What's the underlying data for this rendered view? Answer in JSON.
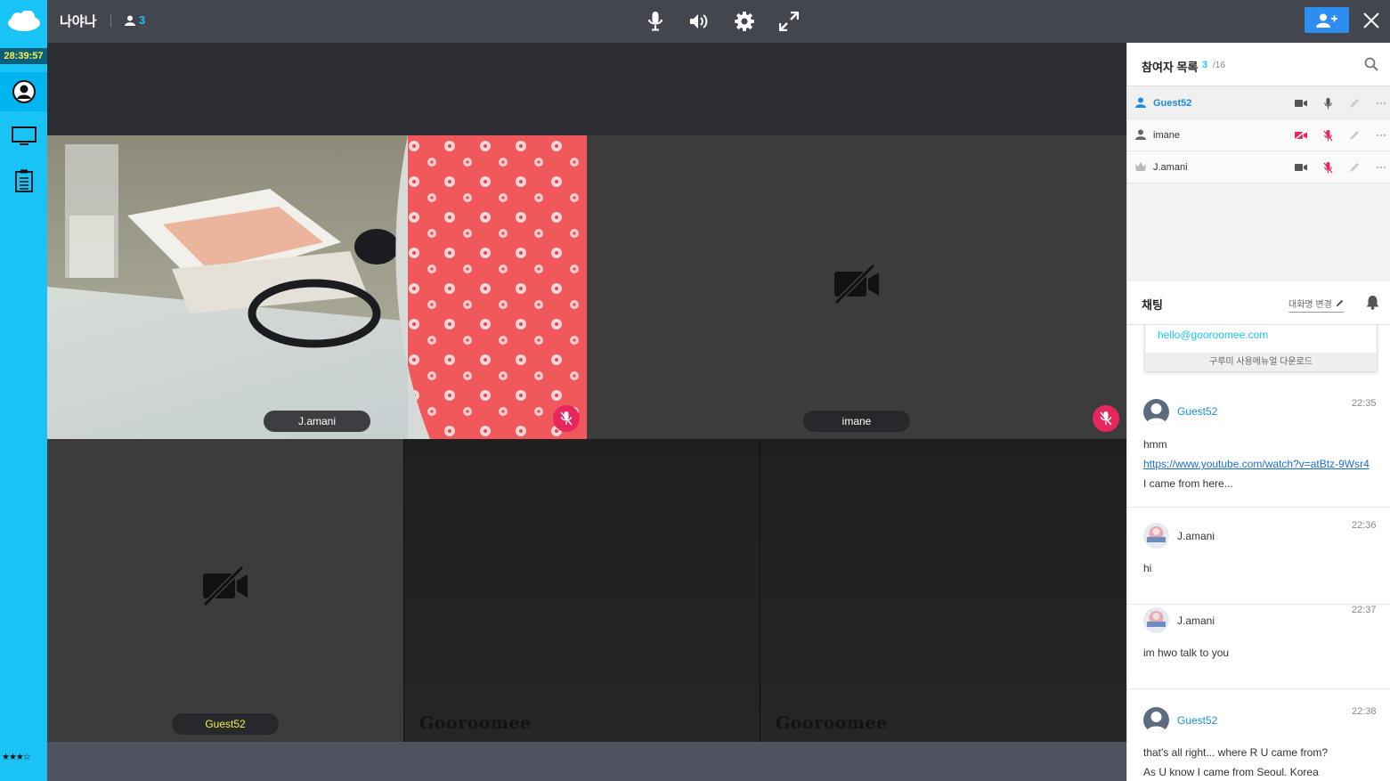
{
  "topbar": {
    "room_name": "나야나",
    "user_count": "3",
    "controls": [
      "microphone-icon",
      "speaker-icon",
      "settings-icon",
      "fullscreen-icon"
    ]
  },
  "sidebar": {
    "timer": "28:39:57",
    "items": [
      "profile-icon",
      "screen-share-icon",
      "clipboard-icon"
    ],
    "rating": "★★★☆"
  },
  "stage": {
    "tiles": [
      {
        "label": "J.amani",
        "video": "on",
        "muted": true
      },
      {
        "label": "imane",
        "video": "off",
        "muted": true
      },
      {
        "label": "Guest52",
        "video": "off",
        "muted": false
      }
    ],
    "empty_watermark": "Gooroomee"
  },
  "participants": {
    "title": "참여자 목록",
    "count": "3",
    "max": "/16",
    "list": [
      {
        "name": "Guest52",
        "is_me": true
      },
      {
        "name": "imane",
        "is_me": false
      },
      {
        "name": "J.amani",
        "is_me": false
      }
    ]
  },
  "chat": {
    "title": "채팅",
    "nickname_change": "대화명 변경",
    "info_email": "hello@gooroomee.com",
    "info_download": "구루미 사용메뉴얼 다운로드",
    "messages": [
      {
        "user": "Guest52",
        "time": "22:35",
        "lines": [
          "hmm",
          "https://www.youtube.com/watch?v=atBtz-9Wsr4",
          "I came from here..."
        ]
      },
      {
        "user": "J.amani",
        "time": "22:36",
        "lines": [
          "hi"
        ]
      },
      {
        "user": "J.amani",
        "time": "22:37",
        "lines": [
          "im hwo talk to you"
        ]
      },
      {
        "user": "Guest52",
        "time": "22:38",
        "lines": [
          "that's all right...  where R U came from?",
          "As U know I came from Seoul. Korea"
        ]
      }
    ]
  },
  "colors": {
    "accent": "#1ac3f5",
    "muted_red": "#e8265e",
    "link_blue": "#1a8be3"
  }
}
